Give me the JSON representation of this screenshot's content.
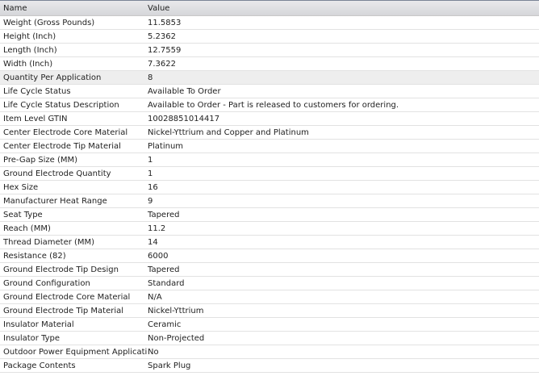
{
  "columns": {
    "name": "Name",
    "value": "Value"
  },
  "selected_row": 4,
  "rows": [
    {
      "name": "Weight (Gross Pounds)",
      "value": "11.5853"
    },
    {
      "name": "Height (Inch)",
      "value": "5.2362"
    },
    {
      "name": "Length (Inch)",
      "value": "12.7559"
    },
    {
      "name": "Width (Inch)",
      "value": "7.3622"
    },
    {
      "name": "Quantity Per Application",
      "value": "8"
    },
    {
      "name": "Life Cycle Status",
      "value": "Available To Order"
    },
    {
      "name": "Life Cycle Status Description",
      "value": "Available to Order - Part is released to customers for ordering."
    },
    {
      "name": "Item Level GTIN",
      "value": "10028851014417"
    },
    {
      "name": "Center Electrode Core Material",
      "value": "Nickel-Yttrium and Copper and Platinum"
    },
    {
      "name": "Center Electrode Tip Material",
      "value": "Platinum"
    },
    {
      "name": "Pre-Gap Size (MM)",
      "value": "1"
    },
    {
      "name": "Ground Electrode Quantity",
      "value": "1"
    },
    {
      "name": "Hex Size",
      "value": "16"
    },
    {
      "name": "Manufacturer Heat Range",
      "value": "9"
    },
    {
      "name": "Seat Type",
      "value": "Tapered"
    },
    {
      "name": "Reach (MM)",
      "value": "11.2"
    },
    {
      "name": "Thread Diameter (MM)",
      "value": "14"
    },
    {
      "name": "Resistance (82)",
      "value": "6000"
    },
    {
      "name": "Ground Electrode Tip Design",
      "value": "Tapered"
    },
    {
      "name": "Ground Configuration",
      "value": "Standard"
    },
    {
      "name": "Ground Electrode Core Material",
      "value": "N/A"
    },
    {
      "name": "Ground Electrode Tip Material",
      "value": "Nickel-Yttrium"
    },
    {
      "name": "Insulator Material",
      "value": "Ceramic"
    },
    {
      "name": "Insulator Type",
      "value": "Non-Projected"
    },
    {
      "name": "Outdoor Power Equipment Application",
      "value": "No"
    },
    {
      "name": "Package Contents",
      "value": "Spark Plug"
    }
  ]
}
